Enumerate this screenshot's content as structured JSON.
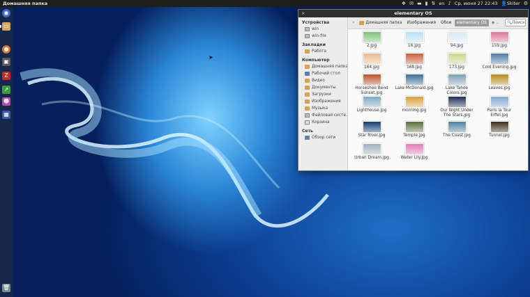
{
  "panel": {
    "title": "Домашняя папка",
    "clock": "Ср, июня 27 22:43",
    "lang": "en",
    "user": "Skiter",
    "icons": [
      "dropbox-icon",
      "mail-icon",
      "tray-icon",
      "battery-icon",
      "network-icon",
      "volume-icon",
      "gear-icon"
    ]
  },
  "launcher": {
    "items": [
      "ubuntu-icon",
      "files-icon",
      "firefox-icon",
      "terminal-icon",
      "filezilla-icon",
      "gimp-icon",
      "tweak-icon",
      "workspace-icon",
      "trash-icon"
    ]
  },
  "window": {
    "title": "elementary OS",
    "close": "×",
    "search_placeholder": "Поиск",
    "breadcrumbs": [
      "Домашняя папка",
      "Изображения",
      "Обои",
      "elementary OS"
    ],
    "sidebar": {
      "devices_header": "Устройства",
      "devices": [
        "win",
        "win-file"
      ],
      "bookmarks_header": "Закладки",
      "bookmarks": [
        "Работа"
      ],
      "computer_header": "Компьютер",
      "computer": [
        "Домашняя папка",
        "Рабочий стол",
        "Видео",
        "Документы",
        "Загрузки",
        "Изображения",
        "Музыка",
        "Файловая систе...",
        "Корзина"
      ],
      "network_header": "Сеть",
      "network": [
        "Обзор сети"
      ]
    },
    "files": [
      {
        "name": "2.jpg",
        "color": "#7fc07a"
      },
      {
        "name": "16.jpg",
        "color": "#b9dff2"
      },
      {
        "name": "94.jpg",
        "color": "#d6e6f2"
      },
      {
        "name": "159.jpg",
        "color": "#d9779a"
      },
      {
        "name": "164.jpg",
        "color": "#e9b88f"
      },
      {
        "name": "168.jpg",
        "color": "#c95f3a"
      },
      {
        "name": "173.jpg",
        "color": "#c7d98a"
      },
      {
        "name": "Cold Evening.jpg",
        "color": "#4f7aa8"
      },
      {
        "name": "Horseshoe Bend Sunset.jpg",
        "color": "#b8552e"
      },
      {
        "name": "Lake McDonald.jpg",
        "color": "#3f6f96"
      },
      {
        "name": "Lake Tahoe Colors.jpg",
        "color": "#7f9fb5"
      },
      {
        "name": "Leaves.jpg",
        "color": "#b58a1f"
      },
      {
        "name": "Lighthouse.jpg",
        "color": "#7ea9c4"
      },
      {
        "name": "morning.jpg",
        "color": "#d8a03a"
      },
      {
        "name": "Our Night Under The Stars.jpg",
        "color": "#1c2f52"
      },
      {
        "name": "Paris la Tour Eiffel.jpg",
        "color": "#7fa6d1"
      },
      {
        "name": "Star River.jpg",
        "color": "#123a6e"
      },
      {
        "name": "Temple.jpg",
        "color": "#5a6f3a"
      },
      {
        "name": "The Coast.jpg",
        "color": "#4f7f9f"
      },
      {
        "name": "Tunnel.jpg",
        "color": "#3a2a1a"
      },
      {
        "name": "Urban Dream.jpg",
        "color": "#9fb0bf"
      },
      {
        "name": "Water Lily.jpg",
        "color": "#e07ab8"
      }
    ]
  }
}
